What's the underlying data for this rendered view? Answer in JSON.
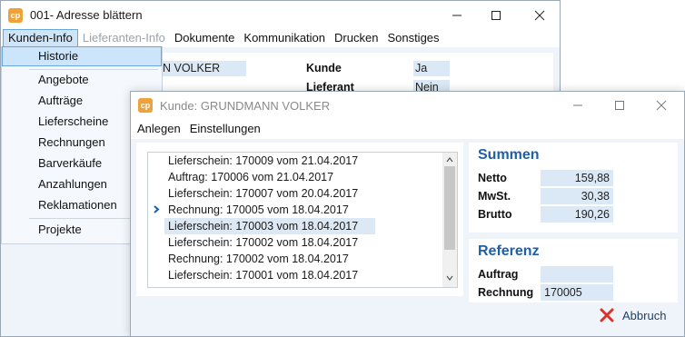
{
  "back_window": {
    "app_icon": "app-logo-icon",
    "title": "001- Adresse blättern",
    "menu": [
      {
        "label": "Kunden-Info",
        "state": "open"
      },
      {
        "label": "Lieferanten-Info",
        "state": "disabled"
      },
      {
        "label": "Dokumente",
        "state": "normal"
      },
      {
        "label": "Kommunikation",
        "state": "normal"
      },
      {
        "label": "Drucken",
        "state": "normal"
      },
      {
        "label": "Sonstiges",
        "state": "normal"
      }
    ],
    "fields": {
      "name_partial": "N VOLKER",
      "kunde_label": "Kunde",
      "kunde_value": "Ja",
      "lieferant_label": "Lieferant",
      "lieferant_value": "Nein"
    }
  },
  "dropdown": {
    "items": [
      {
        "label": "Historie",
        "selected": true
      },
      {
        "label": "Angebote"
      },
      {
        "label": "Aufträge"
      },
      {
        "label": "Lieferscheine"
      },
      {
        "label": "Rechnungen"
      },
      {
        "label": "Barverkäufe"
      },
      {
        "label": "Anzahlungen"
      },
      {
        "label": "Reklamationen"
      },
      {
        "label": "Projekte"
      }
    ]
  },
  "front_window": {
    "app_icon": "app-logo-icon",
    "title": "Kunde: GRUNDMANN VOLKER",
    "menu": [
      "Anlegen",
      "Einstellungen"
    ],
    "list": [
      "Lieferschein: 170009 vom 21.04.2017",
      "Auftrag: 170006 vom 21.04.2017",
      "Lieferschein: 170007 vom 20.04.2017",
      "Rechnung: 170005 vom 18.04.2017",
      "Lieferschein: 170003 vom 18.04.2017",
      "Lieferschein: 170002 vom 18.04.2017",
      "Rechnung: 170002 vom 18.04.2017",
      "Lieferschein: 170001 vom 18.04.2017"
    ],
    "current_row": 3,
    "selected_row": 4,
    "summen": {
      "title": "Summen",
      "netto_label": "Netto",
      "netto_value": "159,88",
      "mwst_label": "MwSt.",
      "mwst_value": "30,38",
      "brutto_label": "Brutto",
      "brutto_value": "190,26"
    },
    "referenz": {
      "title": "Referenz",
      "auftrag_label": "Auftrag",
      "auftrag_value": "",
      "rechnung_label": "Rechnung",
      "rechnung_value": "170005"
    },
    "cancel_label": "Abbruch",
    "cancel_icon": "red-x-icon"
  },
  "colors": {
    "accent_blue": "#1f5fa8",
    "selection": "#cde5fa",
    "field_bg": "#dbe8f5",
    "window_bg": "#eef4fa",
    "app_icon_orange": "#f0a23a",
    "cancel_red": "#d9342b"
  }
}
